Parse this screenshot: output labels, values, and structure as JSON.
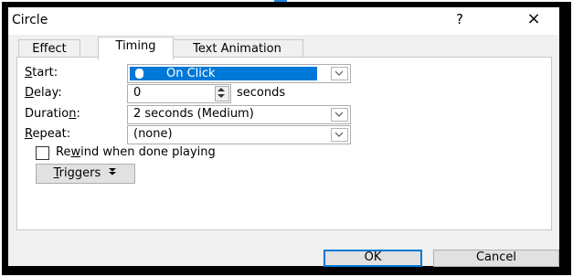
{
  "window": {
    "title": "Circle",
    "help_label": "?",
    "close_label": "×"
  },
  "tabs": [
    {
      "label": "Effect",
      "active": false
    },
    {
      "label": "Timing",
      "active": true
    },
    {
      "label": "Text Animation",
      "active": false
    }
  ],
  "timing": {
    "start": {
      "label_pre": "",
      "label_underline": "S",
      "label_post": "tart:",
      "value": "On Click",
      "icon": "mouse-icon"
    },
    "delay": {
      "label_pre": "",
      "label_underline": "D",
      "label_post": "elay:",
      "value": "0",
      "unit": "seconds"
    },
    "duration": {
      "label_pre": "Duratio",
      "label_underline": "n",
      "label_post": ":",
      "value": "2 seconds (Medium)"
    },
    "repeat": {
      "label_pre": "",
      "label_underline": "R",
      "label_post": "epeat:",
      "value": "(none)"
    },
    "rewind": {
      "label_pre": "Re",
      "label_underline": "w",
      "label_post": "ind when done playing",
      "checked": false
    },
    "triggers": {
      "label_pre": "",
      "label_underline": "T",
      "label_post": "riggers",
      "icon": "double-chevron-down-icon"
    }
  },
  "buttons": {
    "ok": "OK",
    "cancel": "Cancel"
  },
  "colors": {
    "selection": "#0078d7",
    "frame": "#000000",
    "dialog_bg": "#f0f0f0"
  }
}
